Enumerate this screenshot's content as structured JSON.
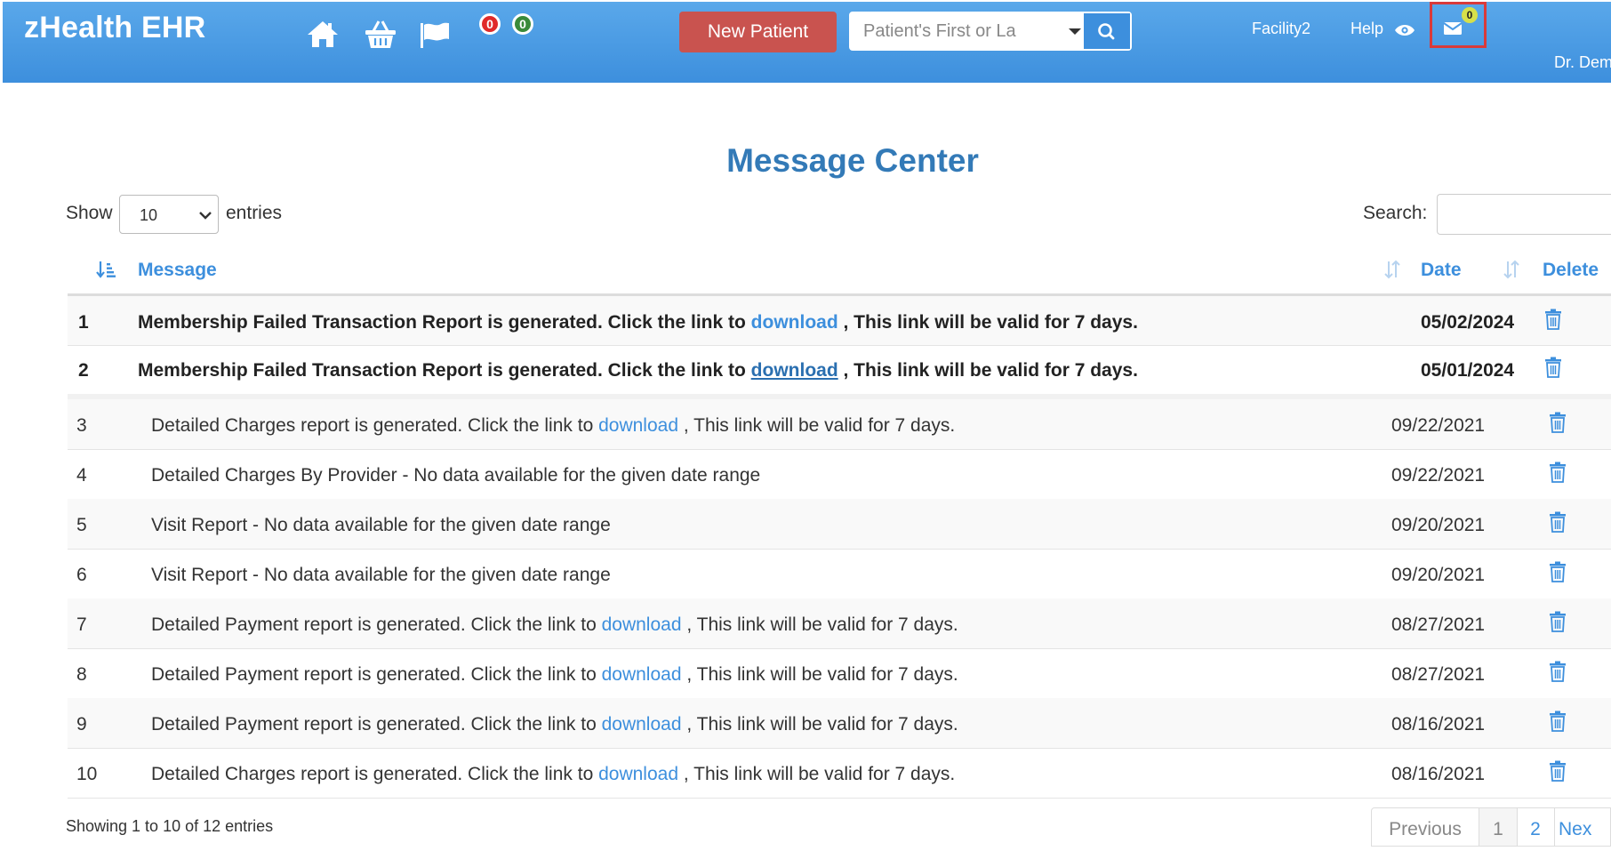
{
  "header": {
    "brand": "zHealth EHR",
    "badges": [
      "0",
      "0"
    ],
    "new_patient_label": "New Patient",
    "search_placeholder": "Patient's First or La",
    "facility": "Facility2",
    "help": "Help",
    "mail_count": "0",
    "user": "Dr. Dem"
  },
  "page": {
    "title": "Message Center",
    "show_label": "Show",
    "entries_value": "10",
    "entries_label": "entries",
    "search_label": "Search:"
  },
  "table": {
    "headers": {
      "message": "Message",
      "date": "Date",
      "delete": "Delete"
    },
    "rows": [
      {
        "num": "1",
        "pre": "Membership Failed Transaction Report is generated. Click the link to ",
        "link": "download",
        "post": " , This link will be valid for 7 days.",
        "date": "05/02/2024"
      },
      {
        "num": "2",
        "pre": "Membership Failed Transaction Report is generated. Click the link to ",
        "link": "download",
        "post": " , This link will be valid for 7 days.",
        "date": "05/01/2024"
      },
      {
        "num": "3",
        "pre": "Detailed Charges report is generated. Click the link to ",
        "link": "download",
        "post": " , This link will be valid for 7 days.",
        "date": "09/22/2021"
      },
      {
        "num": "4",
        "pre": "Detailed Charges By Provider - No data available for the given date range",
        "link": "",
        "post": "",
        "date": "09/22/2021"
      },
      {
        "num": "5",
        "pre": "Visit Report - No data available for the given date range",
        "link": "",
        "post": "",
        "date": "09/20/2021"
      },
      {
        "num": "6",
        "pre": "Visit Report - No data available for the given date range",
        "link": "",
        "post": "",
        "date": "09/20/2021"
      },
      {
        "num": "7",
        "pre": "Detailed Payment report is generated. Click the link to ",
        "link": "download",
        "post": " , This link will be valid for 7 days.",
        "date": "08/27/2021"
      },
      {
        "num": "8",
        "pre": "Detailed Payment report is generated. Click the link to ",
        "link": "download",
        "post": " , This link will be valid for 7 days.",
        "date": "08/27/2021"
      },
      {
        "num": "9",
        "pre": "Detailed Payment report is generated. Click the link to ",
        "link": "download",
        "post": " , This link will be valid for 7 days.",
        "date": "08/16/2021"
      },
      {
        "num": "10",
        "pre": "Detailed Charges report is generated. Click the link to ",
        "link": "download",
        "post": " , This link will be valid for 7 days.",
        "date": "08/16/2021"
      }
    ]
  },
  "footer": {
    "info": "Showing 1 to 10 of 12 entries",
    "previous": "Previous",
    "page1": "1",
    "page2": "2",
    "next": "Nex"
  },
  "colors": {
    "header": "#4a9be6",
    "accent": "#3d8fdd",
    "new_patient": "#c9534f"
  }
}
